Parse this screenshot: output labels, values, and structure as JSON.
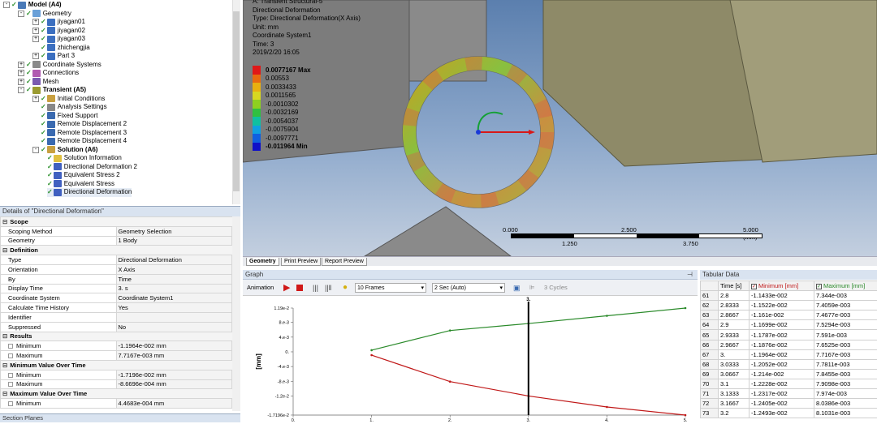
{
  "tree": {
    "items": [
      {
        "label": "Model (A4)",
        "bold": true,
        "x": 4,
        "tw": "-",
        "color": "#4a7ab8"
      },
      {
        "label": "Geometry",
        "x": 22,
        "tw": "-",
        "color": "#6aa0d8"
      },
      {
        "label": "jiyagan01",
        "x": 40,
        "tw": "+",
        "color": "#3b6fc0"
      },
      {
        "label": "jiyagan02",
        "x": 40,
        "tw": "+",
        "color": "#3b6fc0"
      },
      {
        "label": "jiyagan03",
        "x": 40,
        "tw": "+",
        "color": "#3b6fc0"
      },
      {
        "label": "zhichengjia",
        "x": 50,
        "tw": "",
        "color": "#3b6fc0"
      },
      {
        "label": "Part 3",
        "x": 40,
        "tw": "+",
        "color": "#3b6fc0"
      },
      {
        "label": "Coordinate Systems",
        "x": 22,
        "tw": "+",
        "color": "#8a8a8a"
      },
      {
        "label": "Connections",
        "x": 22,
        "tw": "+",
        "color": "#b05ab0"
      },
      {
        "label": "Mesh",
        "x": 22,
        "tw": "+",
        "color": "#7a5ab0"
      },
      {
        "label": "Transient (A5)",
        "bold": true,
        "x": 22,
        "tw": "-",
        "color": "#9a9a30"
      },
      {
        "label": "Initial Conditions",
        "x": 40,
        "tw": "+",
        "color": "#c8a040"
      },
      {
        "label": "Analysis Settings",
        "x": 50,
        "tw": "",
        "color": "#888"
      },
      {
        "label": "Fixed Support",
        "x": 50,
        "tw": "",
        "color": "#3a6ab0"
      },
      {
        "label": "Remote Displacement 2",
        "x": 50,
        "tw": "",
        "color": "#3a6ab0"
      },
      {
        "label": "Remote Displacement 3",
        "x": 50,
        "tw": "",
        "color": "#3a6ab0"
      },
      {
        "label": "Remote Displacement 4",
        "x": 50,
        "tw": "",
        "color": "#3a6ab0"
      },
      {
        "label": "Solution (A6)",
        "bold": true,
        "x": 40,
        "tw": "-",
        "color": "#c8a040"
      },
      {
        "label": "Solution Information",
        "x": 58,
        "tw": "",
        "color": "#e0c040"
      },
      {
        "label": "Directional Deformation 2",
        "x": 58,
        "tw": "",
        "color": "#4060c0"
      },
      {
        "label": "Equivalent Stress 2",
        "x": 58,
        "tw": "",
        "color": "#4060c0"
      },
      {
        "label": "Equivalent Stress",
        "x": 58,
        "tw": "",
        "color": "#4060c0"
      },
      {
        "label": "Directional Deformation",
        "x": 58,
        "tw": "",
        "color": "#4060c0",
        "selected": true
      }
    ]
  },
  "details": {
    "title": "Details of \"Directional Deformation\"",
    "rows": [
      {
        "section": "Scope"
      },
      {
        "k": "Scoping Method",
        "v": "Geometry Selection"
      },
      {
        "k": "Geometry",
        "v": "1 Body"
      },
      {
        "section": "Definition"
      },
      {
        "k": "Type",
        "v": "Directional Deformation"
      },
      {
        "k": "Orientation",
        "v": "X Axis"
      },
      {
        "k": "By",
        "v": "Time"
      },
      {
        "k": "Display Time",
        "v": "3. s"
      },
      {
        "k": "Coordinate System",
        "v": "Coordinate System1"
      },
      {
        "k": "Calculate Time History",
        "v": "Yes"
      },
      {
        "k": "Identifier",
        "v": ""
      },
      {
        "k": "Suppressed",
        "v": "No"
      },
      {
        "section": "Results"
      },
      {
        "k": "Minimum",
        "v": "-1.1964e-002 mm",
        "cb": true
      },
      {
        "k": "Maximum",
        "v": "7.7167e-003 mm",
        "cb": true
      },
      {
        "section": "Minimum Value Over Time"
      },
      {
        "k": "Minimum",
        "v": "-1.7196e-002 mm",
        "cb": true
      },
      {
        "k": "Maximum",
        "v": "-8.6696e-004 mm",
        "cb": true
      },
      {
        "section": "Maximum Value Over Time"
      },
      {
        "k": "Minimum",
        "v": "4.4683e-004 mm",
        "cb": true
      }
    ]
  },
  "section_planes": "Section Planes",
  "viewport": {
    "info": [
      "A: Transient Structural-5",
      "Directional Deformation",
      "Type: Directional Deformation(X Axis)",
      "Unit: mm",
      "Coordinate System1",
      "Time: 3",
      "2019/2/20 16:05"
    ],
    "legend": [
      {
        "label": "0.0077167 Max",
        "color": "#e01818",
        "bold": true
      },
      {
        "label": "0.00553",
        "color": "#e86a10"
      },
      {
        "label": "0.0033433",
        "color": "#e8b010"
      },
      {
        "label": "0.0011565",
        "color": "#d8d820"
      },
      {
        "label": "-0.0010302",
        "color": "#8ed020"
      },
      {
        "label": "-0.0032169",
        "color": "#30c040"
      },
      {
        "label": "-0.0054037",
        "color": "#10c0a0"
      },
      {
        "label": "-0.0075904",
        "color": "#10a0e0"
      },
      {
        "label": "-0.0097771",
        "color": "#1060e0"
      },
      {
        "label": "-0.011964 Min",
        "color": "#1010c8",
        "bold": true
      }
    ],
    "scale": {
      "t0": "0.000",
      "t1": "2.500",
      "t2": "5.000 (mm)",
      "b1": "1.250",
      "b2": "3.750"
    },
    "tabs": [
      "Geometry",
      "Print Preview",
      "Report Preview"
    ]
  },
  "graph": {
    "title": "Graph",
    "animation_label": "Animation",
    "frames": "10 Frames",
    "duration": "2 Sec (Auto)",
    "cycles": "3 Cycles",
    "pin": "4"
  },
  "chart_data": {
    "type": "line",
    "ylabel": "[mm]",
    "x_ticks": [
      "0.",
      "1.",
      "2.",
      "3.",
      "4.",
      "5."
    ],
    "y_ticks": [
      "1.19e-2",
      "8.e-3",
      "4.e-3",
      "0.",
      "-4.e-3",
      "-8.e-3",
      "-1.2e-2",
      "-1.7196e-2"
    ],
    "cursor_label": "3.",
    "cursor_x": 3,
    "series": [
      {
        "name": "Maximum [mm]",
        "color": "#2a8a2a",
        "x": [
          1,
          2,
          3,
          4,
          5
        ],
        "y": [
          0.00045,
          0.0058,
          0.0077,
          0.0098,
          0.0119
        ]
      },
      {
        "name": "Minimum [mm]",
        "color": "#c01818",
        "x": [
          1,
          2,
          3,
          4,
          5
        ],
        "y": [
          -0.0009,
          -0.0081,
          -0.012,
          -0.015,
          -0.0172
        ]
      }
    ]
  },
  "tabular": {
    "title": "Tabular Data",
    "headers": [
      "",
      "Time [s]",
      "Minimum [mm]",
      "Maximum [mm]"
    ],
    "header_colors": [
      "#000",
      "#000",
      "#c01818",
      "#2a8a2a"
    ],
    "rows": [
      [
        "61",
        "2.8",
        "-1.1433e-002",
        "7.344e-003"
      ],
      [
        "62",
        "2.8333",
        "-1.1522e-002",
        "7.4059e-003"
      ],
      [
        "63",
        "2.8667",
        "-1.161e-002",
        "7.4677e-003"
      ],
      [
        "64",
        "2.9",
        "-1.1699e-002",
        "7.5294e-003"
      ],
      [
        "65",
        "2.9333",
        "-1.1787e-002",
        "7.591e-003"
      ],
      [
        "66",
        "2.9667",
        "-1.1876e-002",
        "7.6525e-003"
      ],
      [
        "67",
        "3.",
        "-1.1964e-002",
        "7.7167e-003"
      ],
      [
        "68",
        "3.0333",
        "-1.2052e-002",
        "7.7811e-003"
      ],
      [
        "69",
        "3.0667",
        "-1.214e-002",
        "7.8455e-003"
      ],
      [
        "70",
        "3.1",
        "-1.2228e-002",
        "7.9098e-003"
      ],
      [
        "71",
        "3.1333",
        "-1.2317e-002",
        "7.974e-003"
      ],
      [
        "72",
        "3.1667",
        "-1.2405e-002",
        "8.0386e-003"
      ],
      [
        "73",
        "3.2",
        "-1.2493e-002",
        "8.1031e-003"
      ]
    ]
  }
}
